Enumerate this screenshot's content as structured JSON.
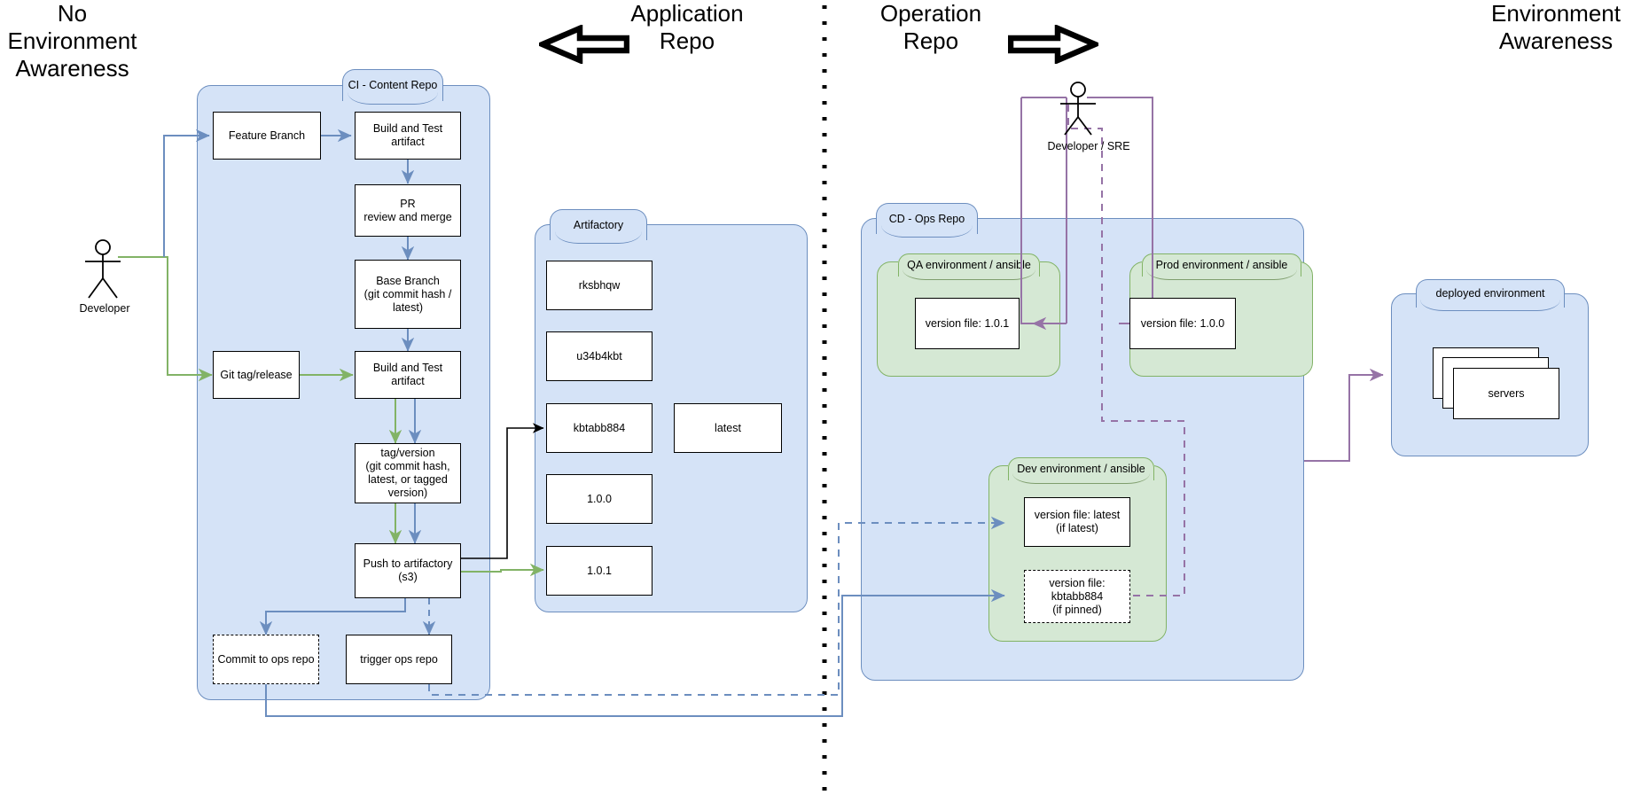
{
  "headings": {
    "left": "No\nEnvironment\nAwareness",
    "app_repo": "Application\nRepo",
    "ops_repo": "Operation\nRepo",
    "right": "Environment\nAwareness"
  },
  "arrows": {
    "left_block_arrow": "block-arrow-left",
    "right_block_arrow": "block-arrow-right"
  },
  "actors": {
    "developer": "Developer",
    "developer_sre": "Developer / SRE"
  },
  "ci_pool": {
    "title": "CI - Content Repo",
    "nodes": {
      "feature_branch": "Feature Branch",
      "build_and_test_1": "Build and Test artifact",
      "pr_review": "PR\nreview and merge",
      "base_branch": "Base Branch\n(git commit hash /\nlatest)",
      "git_tag_release": "Git tag/release",
      "build_and_test_2": "Build and Test artifact",
      "tag_version": "tag/version\n(git commit hash,\nlatest, or tagged\nversion)",
      "push_to_artifactory": "Push to artifactory\n(s3)",
      "commit_to_ops_repo": "Commit to ops repo",
      "trigger_ops_repo": "trigger ops repo"
    }
  },
  "artifactory_pool": {
    "title": "Artifactory",
    "artifacts": [
      "rksbhqw",
      "u34b4kbt",
      "kbtabb884",
      "1.0.0",
      "1.0.1"
    ],
    "latest_tag": "latest"
  },
  "cd_pool": {
    "title": "CD - Ops Repo",
    "environments": [
      {
        "name": "qa",
        "title": "QA environment / ansible",
        "version_file": "version file: 1.0.1",
        "dashed": false
      },
      {
        "name": "prod",
        "title": "Prod environment / ansible",
        "version_file": "version file: 1.0.0",
        "dashed": false
      }
    ],
    "dev_environment": {
      "title": "Dev environment / ansible",
      "version_file_latest": "version file: latest\n(if latest)",
      "version_file_pinned": "version file:\nkbtabb884\n(if pinned)"
    }
  },
  "deployed_pool": {
    "title": "deployed environment",
    "servers": "servers"
  },
  "colors": {
    "pool_blue_fill": "#d5e3f7",
    "pool_blue_stroke": "#6c8ebf",
    "pool_green_fill": "#d5e8d4",
    "pool_green_stroke": "#82b366",
    "arrow_blue": "#6c8ebf",
    "arrow_green": "#82b366",
    "arrow_purple": "#9673a6",
    "arrow_black": "#000000",
    "node_fill": "#ffffff",
    "node_stroke": "#000000"
  }
}
